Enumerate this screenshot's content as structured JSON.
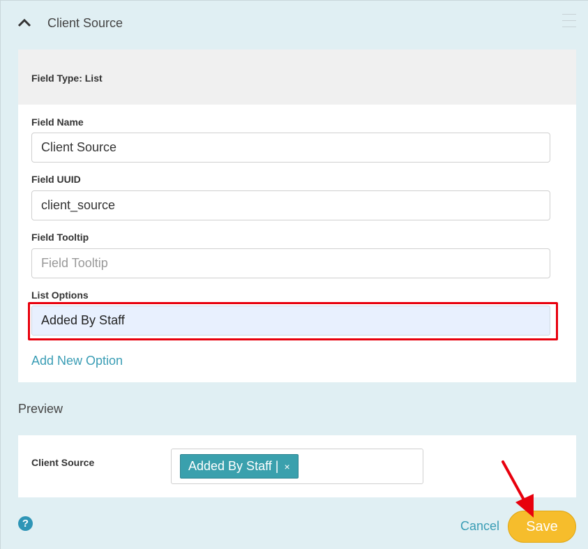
{
  "section": {
    "title": "Client Source",
    "collapse_icon": "chevron-up-icon",
    "drag_icon": "drag-handle-icon"
  },
  "field": {
    "type_label": "Field Type: List",
    "name_label": "Field Name",
    "name_value": "Client Source",
    "uuid_label": "Field UUID",
    "uuid_value": "client_source",
    "tooltip_label": "Field Tooltip",
    "tooltip_placeholder": "Field Tooltip",
    "tooltip_value": "",
    "list_options_label": "List Options",
    "list_options": [
      "Added By Staff"
    ],
    "add_option_label": "Add New Option"
  },
  "preview": {
    "title": "Preview",
    "label": "Client Source",
    "selected_chip": "Added By Staff |",
    "chip_remove": "×"
  },
  "footer": {
    "help_icon": "help-icon",
    "help_glyph": "?",
    "cancel_label": "Cancel",
    "save_label": "Save"
  },
  "colors": {
    "background": "#e0eff3",
    "accent_link": "#3a9db5",
    "chip": "#3aa0ad",
    "save_button": "#f6bd2c",
    "highlight": "#e8000d"
  }
}
